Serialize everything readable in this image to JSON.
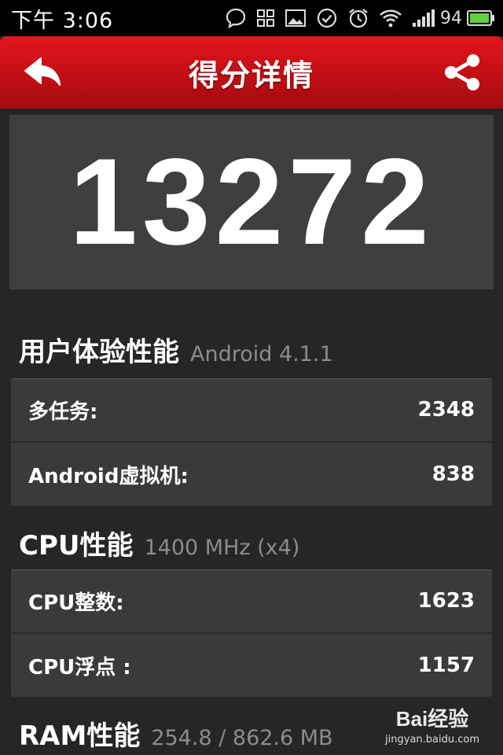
{
  "status_bar": {
    "time": "下午 3:06",
    "battery_percent": "94",
    "icons": [
      "chat-bubble-icon",
      "grid-icon",
      "image-icon",
      "check-circle-icon",
      "alarm-icon",
      "wifi-icon",
      "signal-icon",
      "battery-icon"
    ]
  },
  "app_bar": {
    "title": "得分详情",
    "back_icon": "back-arrow-icon",
    "share_icon": "share-icon",
    "color": "#c8121a"
  },
  "score": "13272",
  "sections": [
    {
      "title": "用户体验性能",
      "subtitle": "Android 4.1.1",
      "rows": [
        {
          "label": "多任务:",
          "value": "2348"
        },
        {
          "label": "Android虚拟机:",
          "value": "838"
        }
      ]
    },
    {
      "title": "CPU性能",
      "subtitle": "1400 MHz (x4)",
      "rows": [
        {
          "label": "CPU整数:",
          "value": "1623"
        },
        {
          "label": "CPU浮点 :",
          "value": "1157"
        }
      ]
    },
    {
      "title": "RAM性能",
      "subtitle": "254.8 / 862.6 MB",
      "rows": []
    }
  ],
  "watermark": {
    "brand": "Bai经验",
    "url": "jingyan.baidu.com"
  }
}
